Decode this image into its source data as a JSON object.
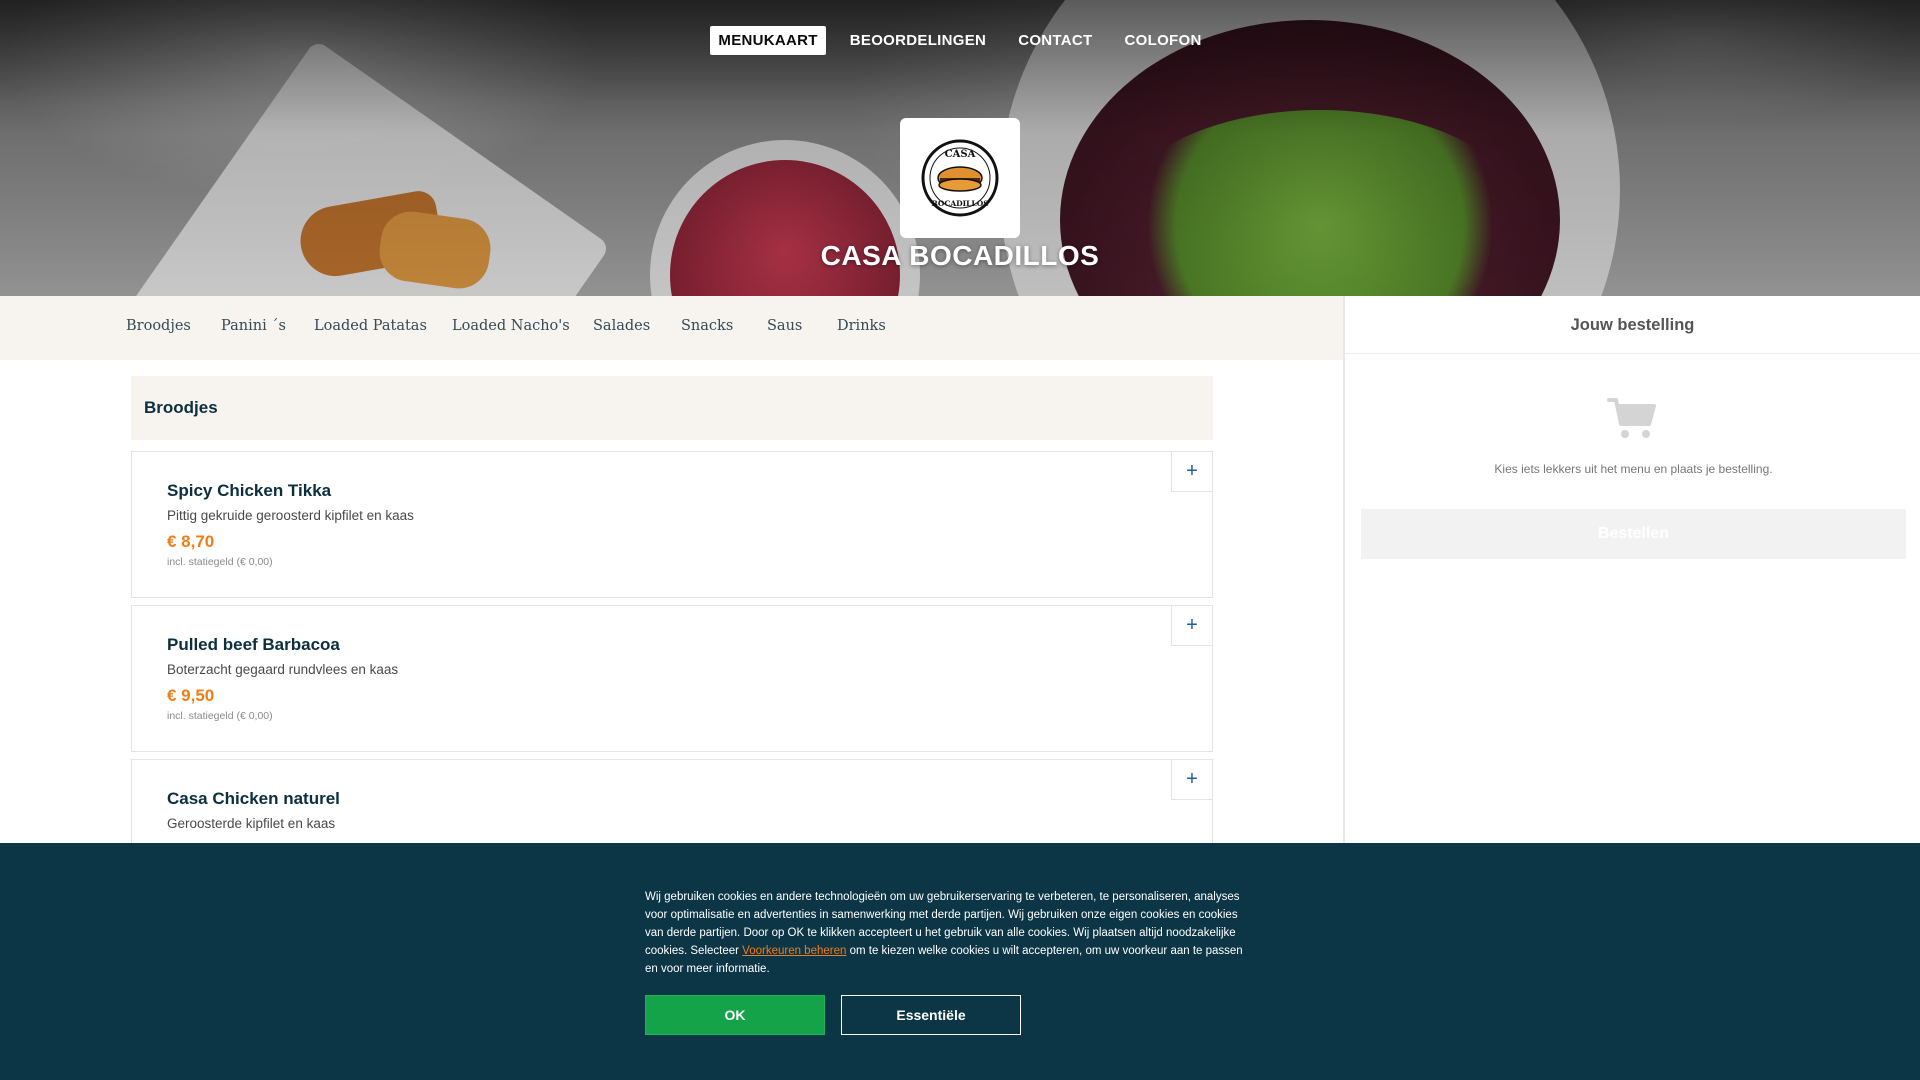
{
  "nav": {
    "items": [
      "MENUKAART",
      "BEOORDELINGEN",
      "CONTACT",
      "COLOFON"
    ],
    "active": "MENUKAART"
  },
  "brand": {
    "name": "CASA BOCADILLOS",
    "logo_text_top": "CASA",
    "logo_text_bottom": "BOCADILLOS"
  },
  "categories": [
    "Broodjes",
    "Panini ´s",
    "Loaded Patatas",
    "Loaded Nacho's",
    "Salades",
    "Snacks",
    "Saus",
    "Drinks"
  ],
  "section": {
    "title": "Broodjes",
    "items": [
      {
        "name": "Spicy Chicken Tikka",
        "description": "Pittig gekruide geroosterd kipfilet en kaas",
        "price": "€ 8,70",
        "deposit": "incl. statiegeld (€ 0,00)"
      },
      {
        "name": "Pulled beef Barbacoa",
        "description": "Boterzacht gegaard rundvlees en kaas",
        "price": "€ 9,50",
        "deposit": "incl. statiegeld (€ 0,00)"
      },
      {
        "name": "Casa Chicken naturel",
        "description": "Geroosterde kipfilet en kaas",
        "price": "",
        "deposit": ""
      }
    ],
    "add_symbol": "+"
  },
  "order": {
    "title": "Jouw bestelling",
    "empty_message": "Kies iets lekkers uit het menu en plaats je bestelling.",
    "button": "Bestellen"
  },
  "cookie": {
    "text_before_link": "Wij gebruiken cookies en andere technologieën om uw gebruikerservaring te verbeteren, te personaliseren, analyses voor optimalisatie en advertenties in samenwerking met derde partijen. Wij gebruiken onze eigen cookies en cookies van derde partijen. Door op OK te klikken accepteert u het gebruik van alle cookies. Wij plaatsen altijd noodzakelijke cookies. Selecteer ",
    "link": "Voorkeuren beheren",
    "text_after_link": " om te kiezen welke cookies u wilt accepteren, om uw voorkeur aan te passen en voor meer informatie.",
    "ok_button": "OK",
    "essential_button": "Essentiële"
  },
  "colors": {
    "accent": "#f07d18",
    "dark": "#0c3646",
    "ok_green": "#15a34a",
    "link_blue": "#1f5ea8"
  },
  "icons": [
    "cart-icon",
    "plus-icon",
    "logo-sandwich-icon"
  ]
}
